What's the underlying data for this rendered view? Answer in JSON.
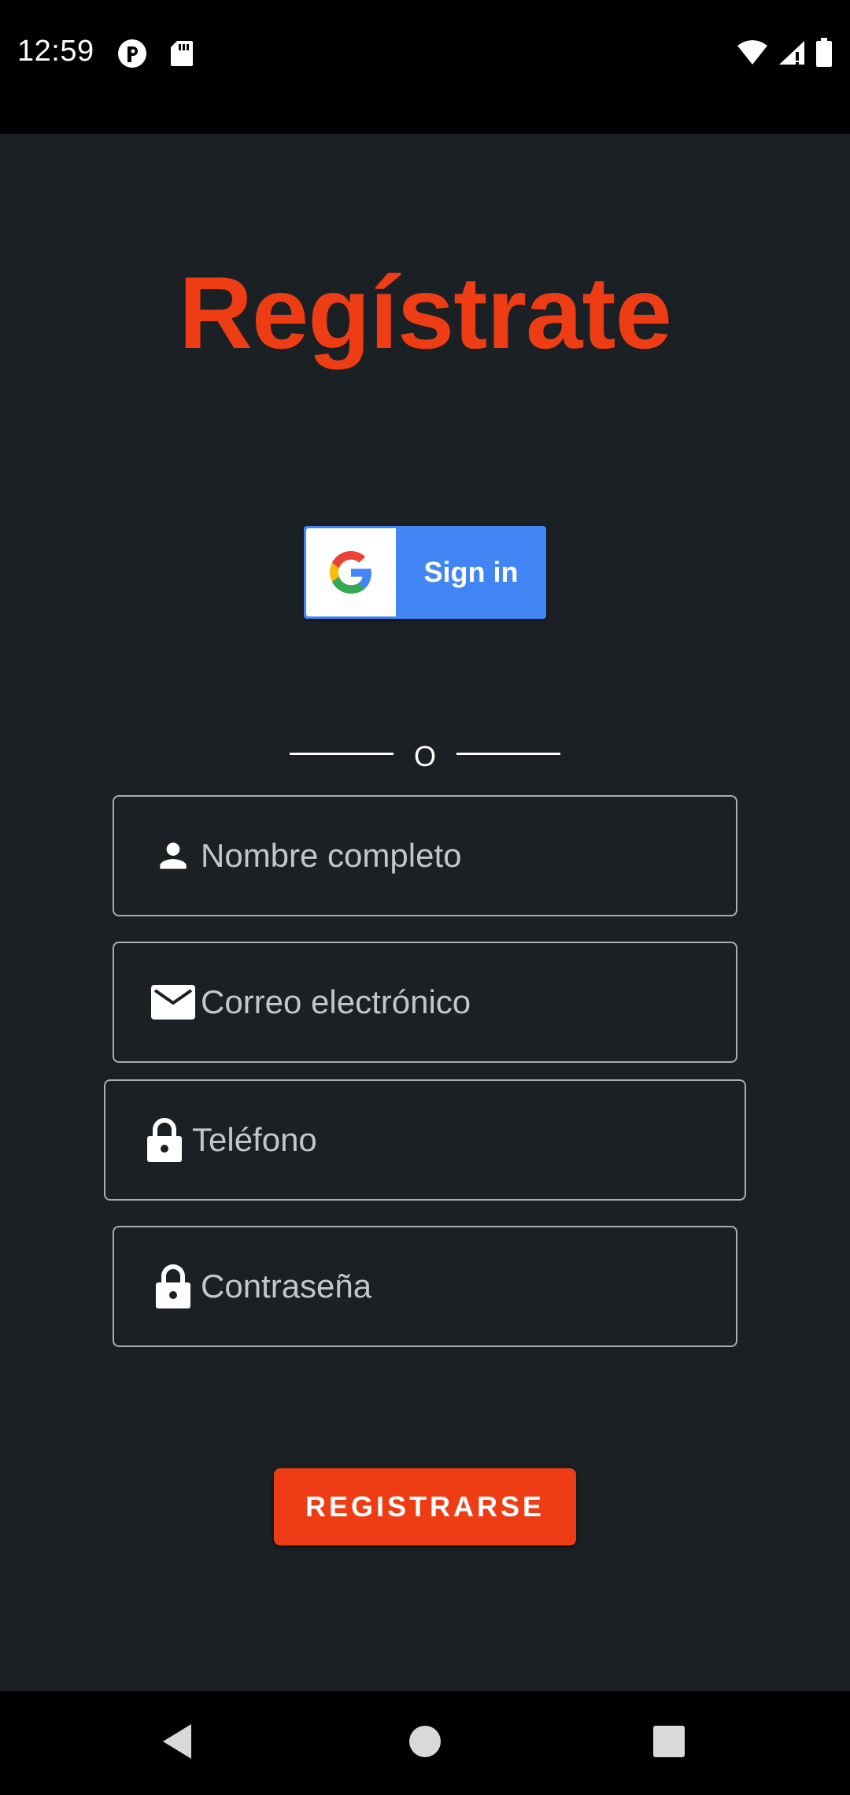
{
  "status_bar": {
    "time": "12:59",
    "icons": [
      "notification-app-icon",
      "sd-card-icon",
      "wifi-icon",
      "cellular-signal-icon",
      "battery-icon"
    ]
  },
  "page": {
    "title": "Regístrate"
  },
  "google_sign_in": {
    "label": "Sign in",
    "icon": "google-logo-icon",
    "color": "#4285f4"
  },
  "divider": {
    "text": "O"
  },
  "form": {
    "full_name": {
      "placeholder": "Nombre completo",
      "value": "",
      "icon": "person-icon"
    },
    "email": {
      "placeholder": "Correo electrónico",
      "value": "",
      "icon": "mail-icon"
    },
    "phone": {
      "placeholder": "Teléfono",
      "value": "",
      "icon": "lock-icon"
    },
    "password": {
      "placeholder": "Contraseña",
      "value": "",
      "icon": "lock-icon"
    }
  },
  "register_button": {
    "label": "REGISTRARSE",
    "color": "#ee3c14"
  },
  "nav_bar": {
    "buttons": [
      "back-icon",
      "home-icon",
      "recents-icon"
    ]
  },
  "colors": {
    "background": "#1b2025",
    "accent": "#ee3c14",
    "field_border": "#a9adb1",
    "placeholder_text": "#c4c7ca"
  }
}
